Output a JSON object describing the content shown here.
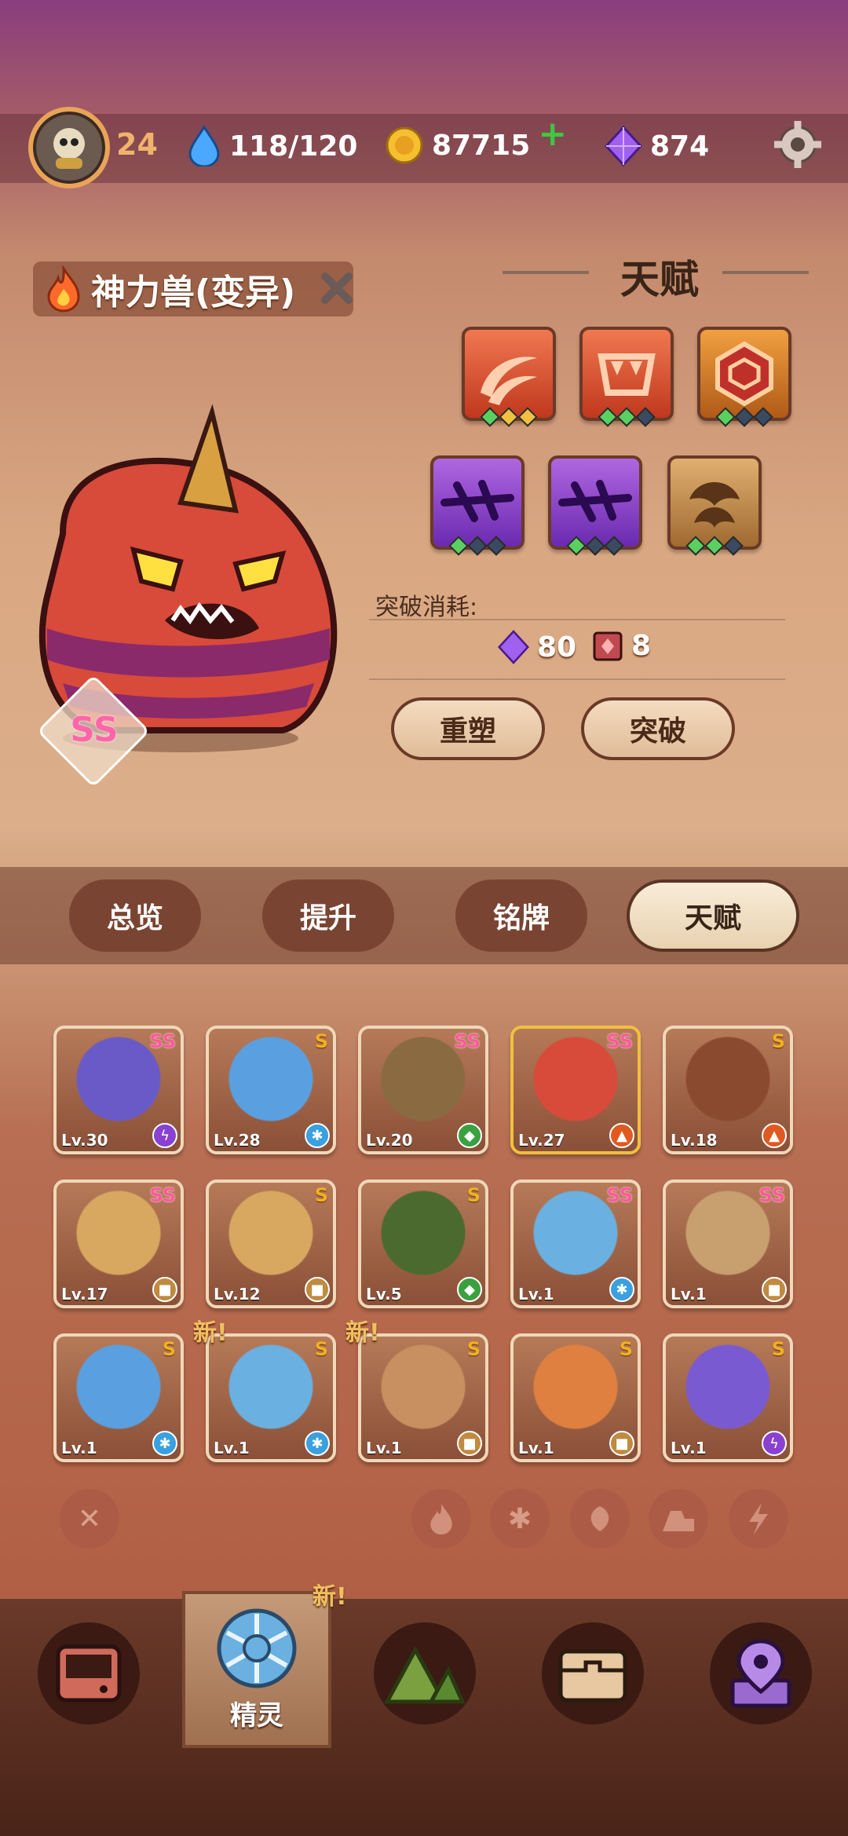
{
  "header": {
    "level": "24",
    "energy": "118/120",
    "gold": "87715",
    "gems": "874"
  },
  "pet": {
    "name": "神力兽(变异)",
    "grade": "SS"
  },
  "talent": {
    "title": "天赋",
    "cost_label": "突破消耗:",
    "cost_gems": "80",
    "cost_items": "8",
    "reshape_label": "重塑",
    "breakthrough_label": "突破"
  },
  "tabs": [
    {
      "label": "总览"
    },
    {
      "label": "提升"
    },
    {
      "label": "铭牌"
    },
    {
      "label": "天赋"
    }
  ],
  "pets": [
    {
      "lv": "Lv.30",
      "rank": "SS",
      "element": "bolt"
    },
    {
      "lv": "Lv.28",
      "rank": "S",
      "element": "ice"
    },
    {
      "lv": "Lv.20",
      "rank": "SS",
      "element": "leaf"
    },
    {
      "lv": "Lv.27",
      "rank": "SS",
      "element": "fire"
    },
    {
      "lv": "Lv.18",
      "rank": "S",
      "element": "fire"
    },
    {
      "lv": "Lv.17",
      "rank": "SS",
      "element": "earth"
    },
    {
      "lv": "Lv.12",
      "rank": "S",
      "element": "earth"
    },
    {
      "lv": "Lv.5",
      "rank": "S",
      "element": "leaf"
    },
    {
      "lv": "Lv.1",
      "rank": "SS",
      "element": "ice"
    },
    {
      "lv": "Lv.1",
      "rank": "SS",
      "element": "earth"
    },
    {
      "lv": "Lv.1",
      "rank": "S",
      "element": "ice"
    },
    {
      "lv": "Lv.1",
      "rank": "S",
      "element": "ice",
      "new": "新!"
    },
    {
      "lv": "Lv.1",
      "rank": "S",
      "element": "earth",
      "new": "新!"
    },
    {
      "lv": "Lv.1",
      "rank": "S",
      "element": "earth"
    },
    {
      "lv": "Lv.1",
      "rank": "S",
      "element": "bolt"
    }
  ],
  "nav": {
    "active_label": "精灵",
    "new_badge": "新!"
  },
  "colors": {
    "accent_gold": "#f0c040",
    "ss_pink": "#ff5a9a"
  }
}
